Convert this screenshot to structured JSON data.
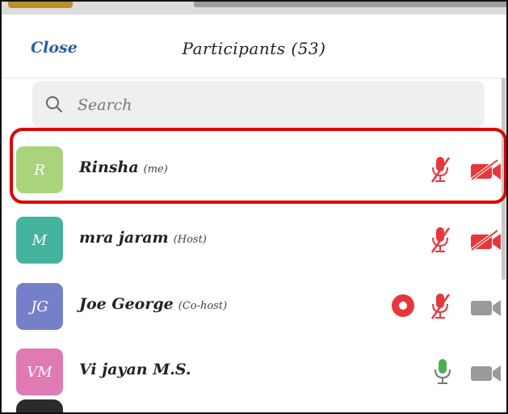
{
  "header": {
    "close_label": "Close",
    "title": "Participants (53)"
  },
  "search": {
    "placeholder": "Search"
  },
  "participants": [
    {
      "initials": "R",
      "name": "Rinsha",
      "role": "(me)",
      "avatar_color": "#a9d47c",
      "mic": "muted",
      "camera": "off",
      "recording": false,
      "highlighted": true
    },
    {
      "initials": "M",
      "name": "mra jaram",
      "role": "(Host)",
      "avatar_color": "#44b39d",
      "mic": "muted",
      "camera": "off",
      "recording": false
    },
    {
      "initials": "JG",
      "name": "Joe George",
      "role": "(Co-host)",
      "avatar_color": "#7680c9",
      "mic": "muted",
      "camera": "off-gray",
      "recording": true
    },
    {
      "initials": "VM",
      "name": "Vi jayan M.S.",
      "role": "",
      "avatar_color": "#e07ab3",
      "mic": "on",
      "camera": "off-gray",
      "recording": false
    }
  ],
  "colors": {
    "accent": "#2a5fa0",
    "muted_red": "#e8373b",
    "mic_on_green": "#4caf50",
    "highlight": "#e00000"
  }
}
